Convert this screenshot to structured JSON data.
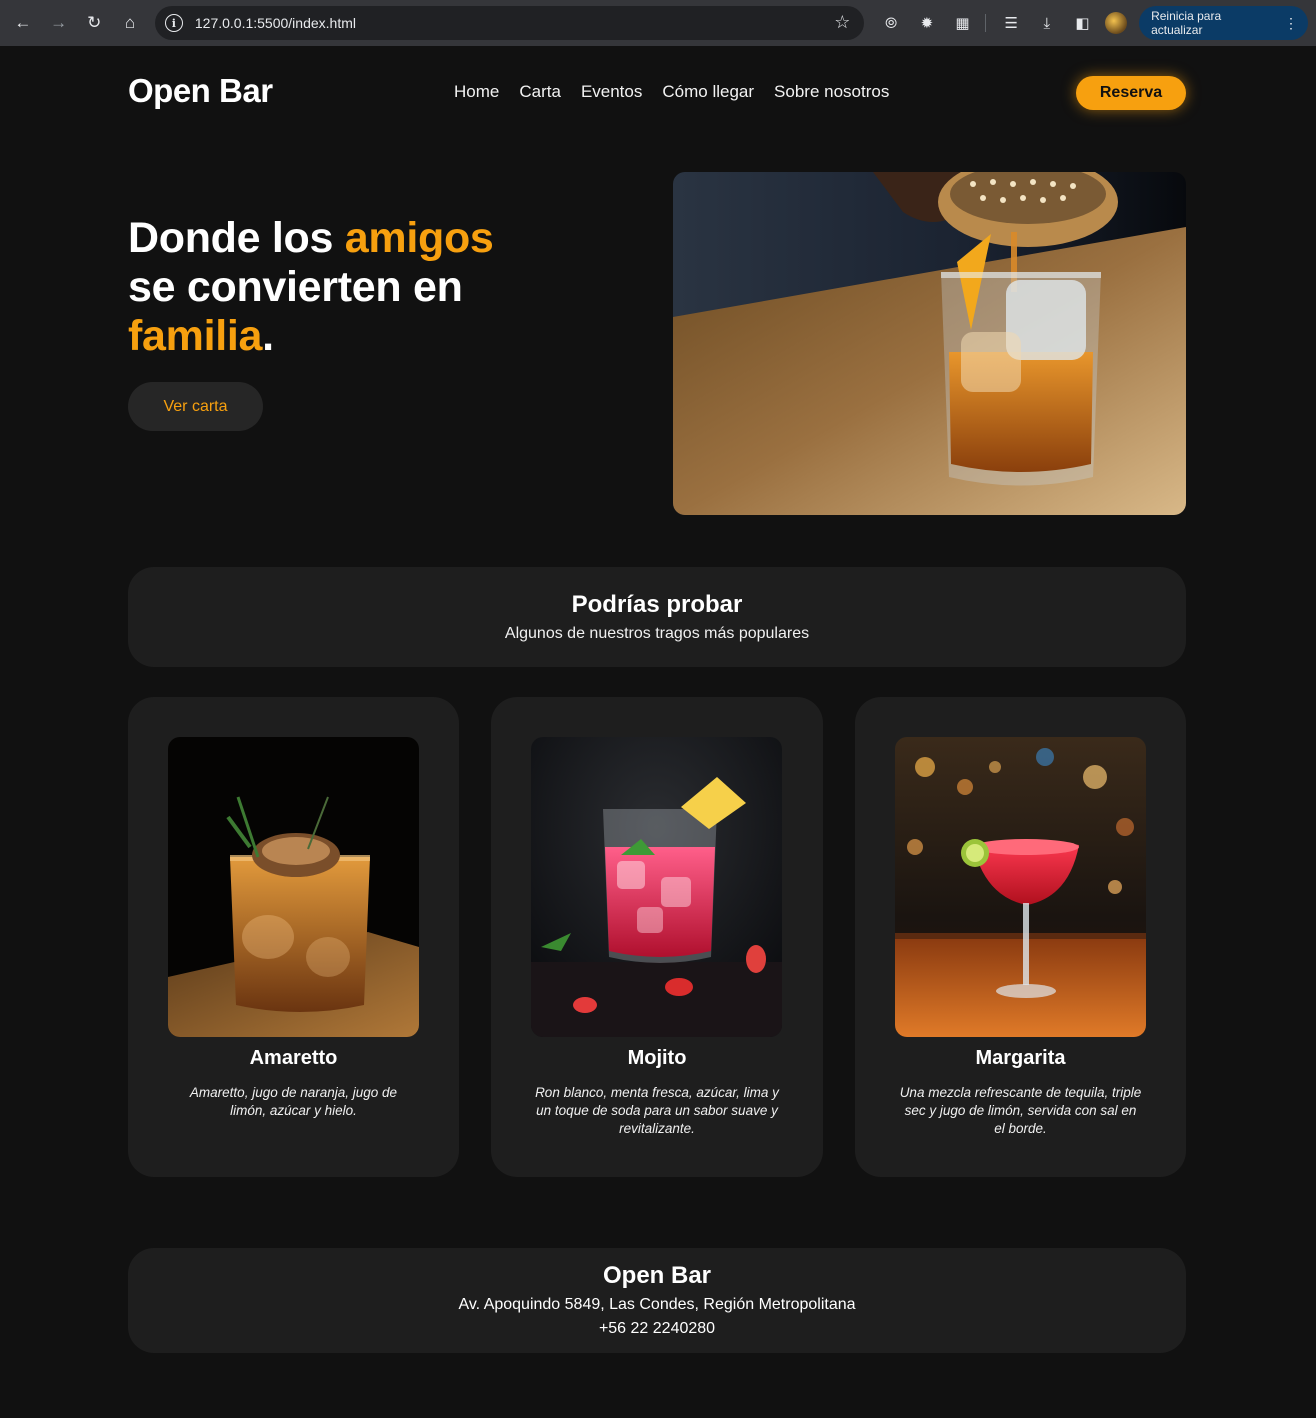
{
  "browser": {
    "url": "127.0.0.1:5500/index.html",
    "update_label": "Reinicia para actualizar"
  },
  "header": {
    "logo": "Open Bar",
    "nav": [
      "Home",
      "Carta",
      "Eventos",
      "Cómo llegar",
      "Sobre nosotros"
    ],
    "reserva_label": "Reserva"
  },
  "hero": {
    "title_part1": "Donde los ",
    "title_accent1": "amigos",
    "title_part2": "se convierten en",
    "title_accent2": "familia",
    "title_end": ".",
    "cta_label": "Ver carta"
  },
  "popular": {
    "title": "Podrías probar",
    "subtitle": "Algunos de nuestros tragos más populares"
  },
  "drinks": [
    {
      "name": "Amaretto",
      "description": "Amaretto, jugo de naranja, jugo de limón, azúcar y hielo."
    },
    {
      "name": "Mojito",
      "description": "Ron blanco, menta fresca, azúcar, lima y un toque de soda para un sabor suave y revitalizante."
    },
    {
      "name": "Margarita",
      "description": "Una mezcla refrescante de tequila, triple sec y jugo de limón, servida con sal en el borde."
    }
  ],
  "footer": {
    "name": "Open Bar",
    "address": "Av. Apoquindo 5849, Las Condes, Región Metropolitana",
    "phone": "+56 22 2240280"
  },
  "colors": {
    "accent": "#f7a00f",
    "background": "#111111",
    "panel": "#1e1e1e"
  }
}
